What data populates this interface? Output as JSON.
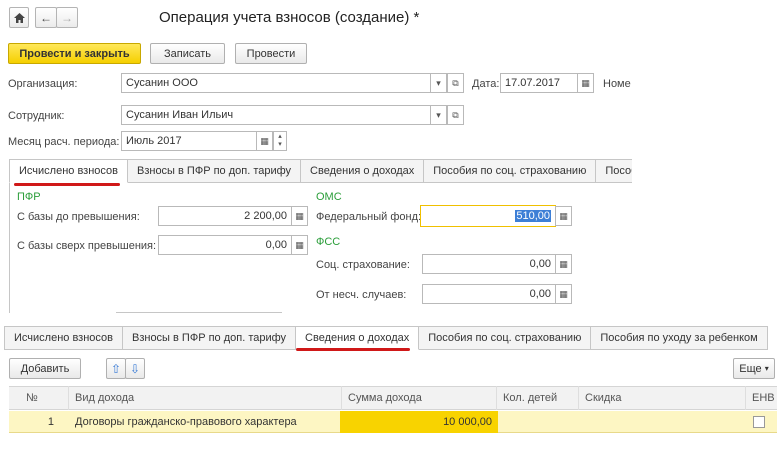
{
  "window": {
    "title": "Операция учета взносов (создание) *"
  },
  "toolbar": {
    "post_close": "Провести и закрыть",
    "save": "Записать",
    "post": "Провести"
  },
  "header": {
    "org_label": "Организация:",
    "org_value": "Сусанин ООО",
    "date_label": "Дата:",
    "date_value": "17.07.2017",
    "number_label": "Номе",
    "employee_label": "Сотрудник:",
    "employee_value": "Сусанин Иван Ильич",
    "period_label": "Месяц расч. периода:",
    "period_value": "Июль 2017"
  },
  "top_tabs": [
    "Исчислено взносов",
    "Взносы в ПФР по доп. тарифу",
    "Сведения о доходах",
    "Пособия по соц. страхованию",
    "Пособ"
  ],
  "contributions": {
    "pfr_group": "ПФР",
    "base_under_label": "С базы до превышения:",
    "base_under_value": "2 200,00",
    "base_over_label": "С базы сверх превышения:",
    "base_over_value": "0,00",
    "oms_group": "ОМС",
    "federal_label": "Федеральный фонд:",
    "federal_value": "510,00",
    "fss_group": "ФСС",
    "social_label": "Соц. страхование:",
    "social_value": "0,00",
    "accident_label": "От несч. случаев:",
    "accident_value": "0,00"
  },
  "bottom_tabs": [
    "Исчислено взносов",
    "Взносы в ПФР по доп. тарифу",
    "Сведения о доходах",
    "Пособия по соц. страхованию",
    "Пособия по уходу за ребенком"
  ],
  "table_toolbar": {
    "add": "Добавить",
    "more": "Еще"
  },
  "table": {
    "columns": [
      "№",
      "Вид дохода",
      "Сумма дохода",
      "Кол. детей",
      "Скидка",
      "ЕНВ"
    ],
    "rows": [
      {
        "num": "1",
        "type": "Договоры гражданско-правового характера",
        "amount": "10 000,00",
        "children": "",
        "discount": ""
      }
    ]
  },
  "colors": {
    "accent_yellow": "#f5cf00",
    "highlight_row": "#fdf6c3",
    "group_green": "#2b9e3a",
    "underline_red": "#d01818"
  }
}
